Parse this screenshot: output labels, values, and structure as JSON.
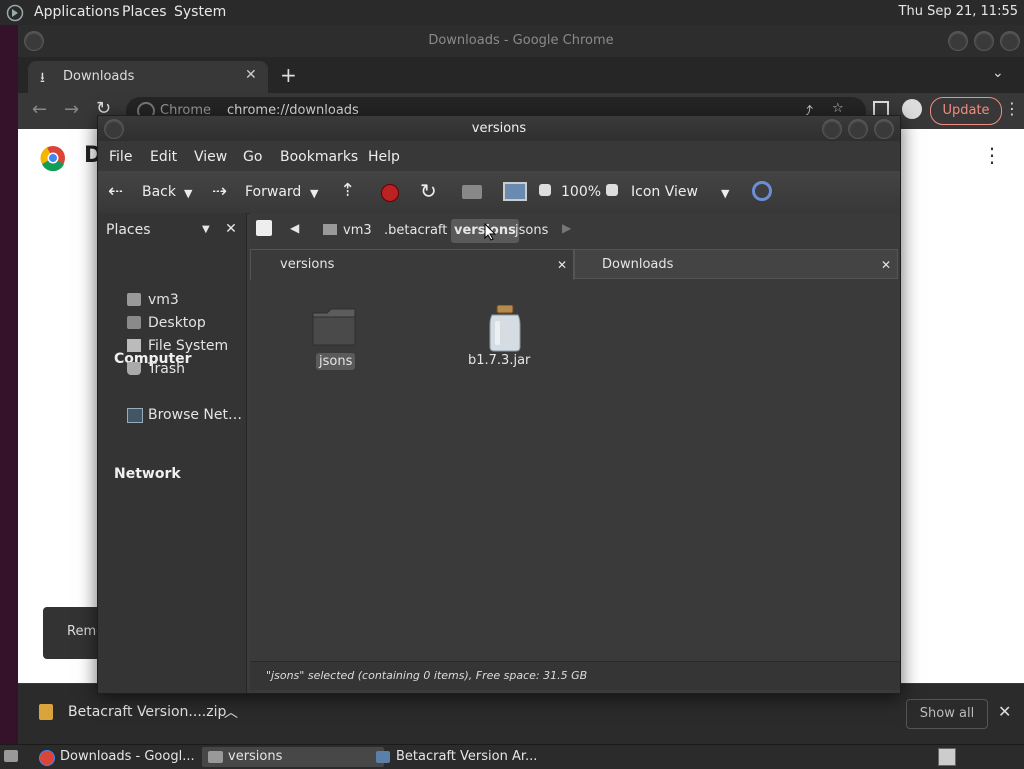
{
  "top_panel": {
    "applications": "Applications",
    "places": "Places",
    "system": "System",
    "clock": "Thu Sep 21, 11:55"
  },
  "chrome": {
    "window_title": "Downloads - Google Chrome",
    "tab_label": "Downloads",
    "omnibox_site": "Chrome",
    "omnibox_url": "chrome://downloads",
    "update_label": "Update",
    "page_heading_partial": "D",
    "remove_partial": "Remo",
    "download_item": "Betacraft Version....zip",
    "show_all": "Show all"
  },
  "file_manager": {
    "title": "versions",
    "menu": [
      "File",
      "Edit",
      "View",
      "Go",
      "Bookmarks",
      "Help"
    ],
    "toolbar": {
      "back": "Back",
      "forward": "Forward",
      "zoom": "100%",
      "view_mode": "Icon View"
    },
    "sidebar": {
      "selector": "Places",
      "computer_heading": "Computer",
      "computer_items": [
        "vm3",
        "Desktop",
        "File System",
        "Trash"
      ],
      "network_heading": "Network",
      "network_items": [
        "Browse Net…"
      ]
    },
    "breadcrumbs": [
      "vm3",
      ".betacraft",
      "versions",
      "jsons"
    ],
    "tabs": [
      "versions",
      "Downloads"
    ],
    "files": [
      {
        "name": "jsons",
        "icon": "folder-icon"
      },
      {
        "name": "b1.7.3.jar",
        "icon": "jar-icon"
      }
    ],
    "status": "\"jsons\" selected (containing 0 items), Free space: 31.5 GB"
  },
  "taskbar": {
    "items": [
      "Downloads - Googl...",
      "versions",
      "Betacraft Version Ar..."
    ]
  },
  "colors": {
    "update_accent": "#f28b82",
    "selection": "#5a5a5a",
    "desktop_bg": "#35112a"
  }
}
